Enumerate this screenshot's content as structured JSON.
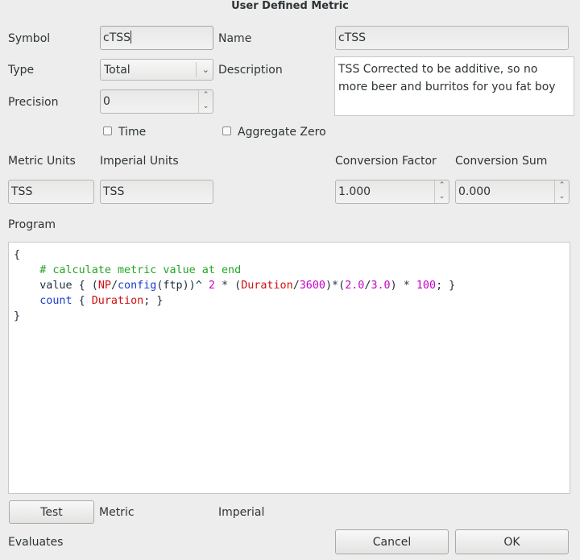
{
  "window": {
    "title": "User Defined Metric"
  },
  "labels": {
    "symbol": "Symbol",
    "name": "Name",
    "type": "Type",
    "description": "Description",
    "precision": "Precision",
    "time": "Time",
    "aggregate_zero": "Aggregate Zero",
    "metric_units": "Metric Units",
    "imperial_units": "Imperial Units",
    "conversion_factor": "Conversion Factor",
    "conversion_sum": "Conversion Sum",
    "program": "Program",
    "metric": "Metric",
    "imperial": "Imperial",
    "evaluates": "Evaluates"
  },
  "fields": {
    "symbol": "cTSS",
    "name": "cTSS",
    "type": "Total",
    "description": "TSS Corrected to be additive, so no more beer and burritos for you fat boy",
    "precision": "0",
    "time_checked": false,
    "aggregate_zero_checked": false,
    "metric_units": "TSS",
    "imperial_units": "TSS",
    "conversion_factor": "1.000",
    "conversion_sum": "0.000"
  },
  "program": {
    "line1": "{",
    "comment": "# calculate metric value at end",
    "value_kw": "value",
    "count_kw": "count",
    "t_open": " { ",
    "t_p1": "(",
    "t_np": "NP",
    "t_slash": "/",
    "t_config": "config",
    "t_ftp": "(ftp))^ ",
    "t_2": "2",
    "t_mul": " * (",
    "t_dur": "Duration",
    "t_slash2": "/",
    "t_3600": "3600",
    "t_mid": ")*(",
    "t_20": "2.0",
    "t_slash3": "/",
    "t_30": "3.0",
    "t_end1": ") * ",
    "t_100": "100",
    "t_close": "; }",
    "c_open": " { ",
    "c_dur": "Duration",
    "c_close": "; }",
    "last": "}"
  },
  "buttons": {
    "test": "Test",
    "cancel": "Cancel",
    "ok": "OK"
  },
  "icons": {
    "combo_arrow": "chevron-down-icon",
    "spin_up": "spin-up-icon",
    "spin_down": "spin-down-icon"
  }
}
